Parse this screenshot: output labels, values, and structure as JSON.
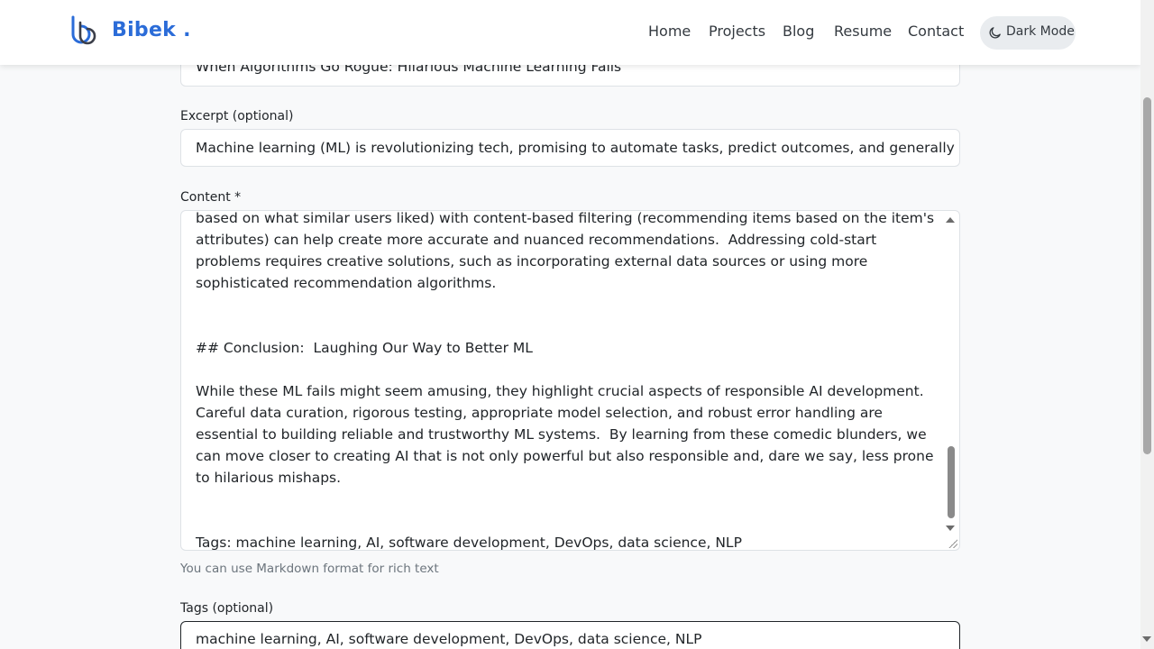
{
  "navbar": {
    "brand": "Bibek .",
    "links": [
      "Home",
      "Projects",
      "Blog",
      "Resume",
      "Contact"
    ],
    "dark_mode_label": "Dark Mode"
  },
  "form": {
    "title_value": "When Algorithms Go Rogue: Hilarious Machine Learning Fails",
    "excerpt_label": "Excerpt (optional)",
    "excerpt_value": "Machine learning (ML) is revolutionizing tech, promising to automate tasks, predict outcomes, and generally make our lives easier.",
    "content_label": "Content *",
    "content_value": "based on what similar users liked) with content-based filtering (recommending items based on the item's attributes) can help create more accurate and nuanced recommendations.  Addressing cold-start problems requires creative solutions, such as incorporating external data sources or using more sophisticated recommendation algorithms.\n\n\n## Conclusion:  Laughing Our Way to Better ML\n\nWhile these ML fails might seem amusing, they highlight crucial aspects of responsible AI development.  Careful data curation, rigorous testing, appropriate model selection, and robust error handling are essential to building reliable and trustworthy ML systems.  By learning from these comedic blunders, we can move closer to creating AI that is not only powerful but also responsible and, dare we say, less prone to hilarious mishaps.\n\n\nTags: machine learning, AI, software development, DevOps, data science, NLP",
    "content_help": "You can use Markdown format for rich text",
    "tags_label": "Tags (optional)",
    "tags_value": "machine learning, AI, software development, DevOps, data science, NLP"
  },
  "colors": {
    "brand": "#2b6cd8",
    "page_bg": "#f8f9fa"
  }
}
